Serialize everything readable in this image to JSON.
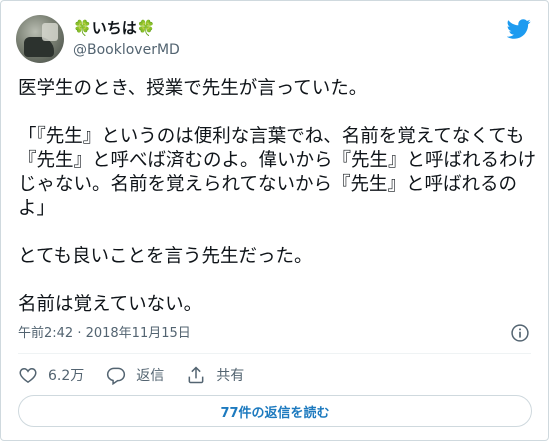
{
  "user": {
    "display_name_prefix": "🍀",
    "display_name_text": "いちは",
    "display_name_suffix": "🍀",
    "handle": "@BookloverMD"
  },
  "tweet": {
    "text": "医学生のとき、授業で先生が言っていた。\n\n「『先生』というのは便利な言葉でね、名前を覚えてなくても『先生』と呼べば済むのよ。偉いから『先生』と呼ばれるわけじゃない。名前を覚えられてないから『先生』と呼ばれるのよ」\n\nとても良いことを言う先生だった。\n\n名前は覚えていない。",
    "timestamp": "午前2:42 · 2018年11月15日"
  },
  "actions": {
    "like_count": "6.2万",
    "reply_label": "返信",
    "share_label": "共有"
  },
  "replies_button_label": "77件の返信を読む",
  "colors": {
    "accent": "#1d9bf0",
    "muted": "#536471",
    "border": "#cfd9de"
  },
  "icons": [
    "twitter-bird-icon",
    "info-icon",
    "heart-icon",
    "reply-icon",
    "share-icon"
  ]
}
